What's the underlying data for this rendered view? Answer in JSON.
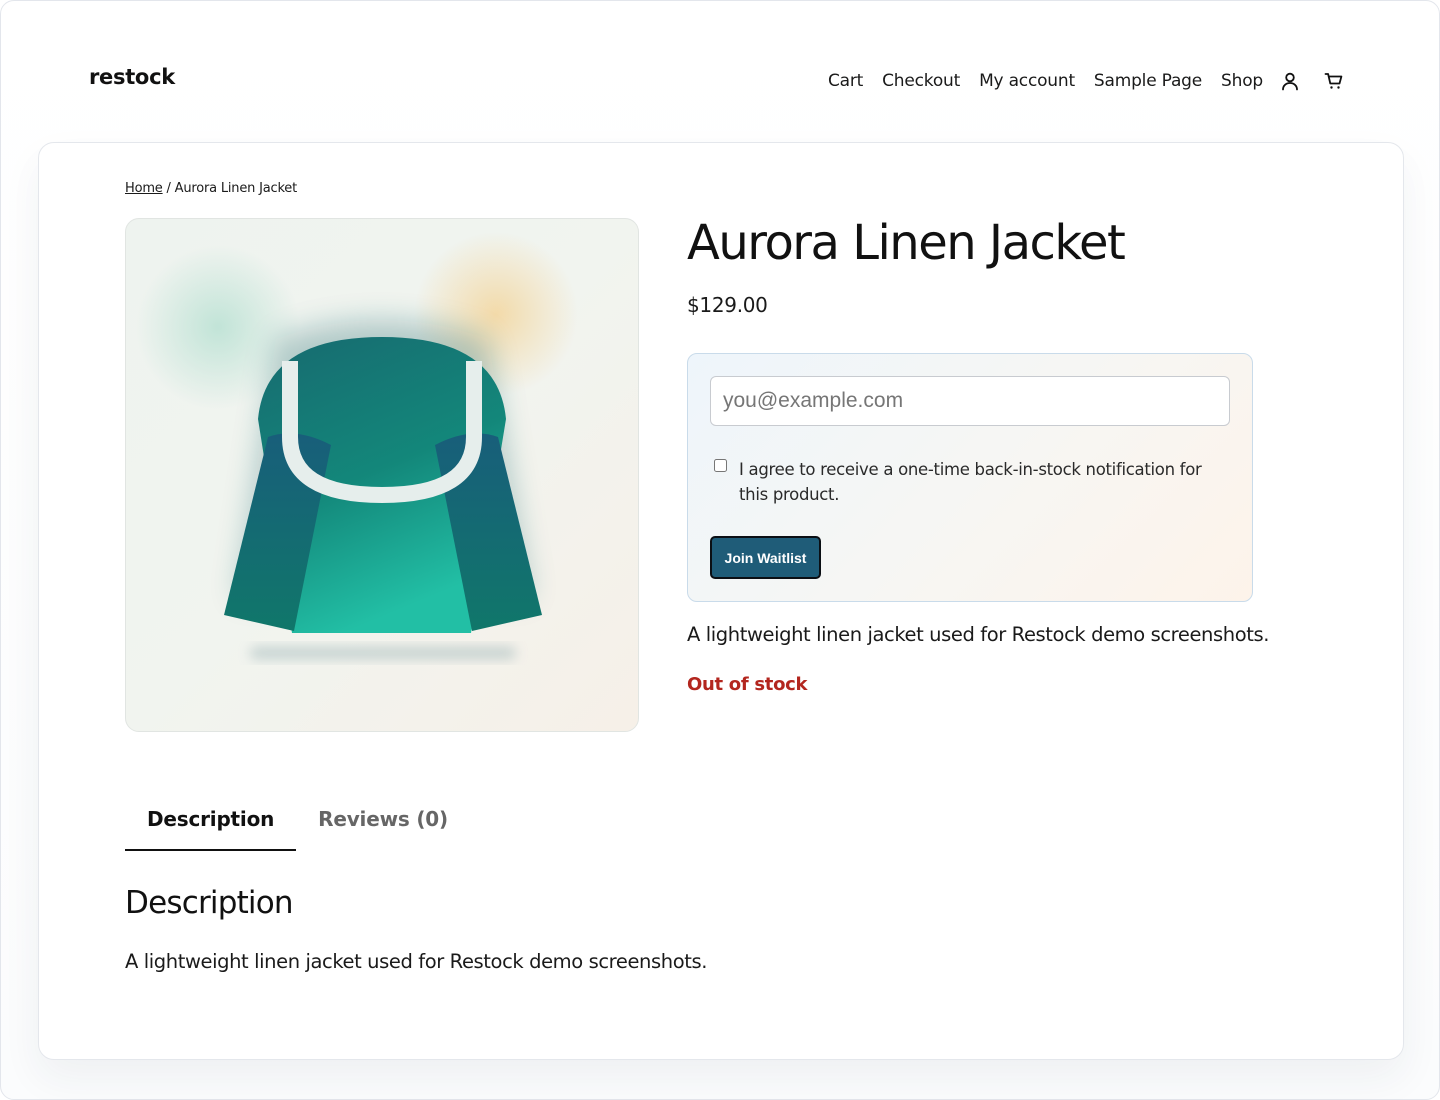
{
  "site": {
    "logo": "restock"
  },
  "nav": {
    "items": [
      "Cart",
      "Checkout",
      "My account",
      "Sample Page",
      "Shop"
    ],
    "account_icon": "user-icon",
    "cart_icon": "cart-icon"
  },
  "breadcrumb": {
    "home": "Home",
    "separator": " / ",
    "current": "Aurora Linen Jacket"
  },
  "product": {
    "title": "Aurora Linen Jacket",
    "price": "$129.00",
    "image_icon": "jacket-illustration",
    "short_description": "A lightweight linen jacket used for Restock demo screenshots.",
    "stock_status": "Out of stock"
  },
  "waitlist": {
    "email_placeholder": "you@example.com",
    "email_value": "",
    "consent_label": "I agree to receive a one-time back-in-stock notification for this product.",
    "consent_checked": false,
    "button_label": "Join Waitlist"
  },
  "tabs": [
    {
      "label": "Description",
      "active": true
    },
    {
      "label": "Reviews (0)",
      "active": false
    }
  ],
  "description": {
    "heading": "Description",
    "body": "A lightweight linen jacket used for Restock demo screenshots."
  },
  "colors": {
    "accent": "#1f5c78",
    "out_of_stock": "#b3261e",
    "jacket": "#1a7a73"
  }
}
